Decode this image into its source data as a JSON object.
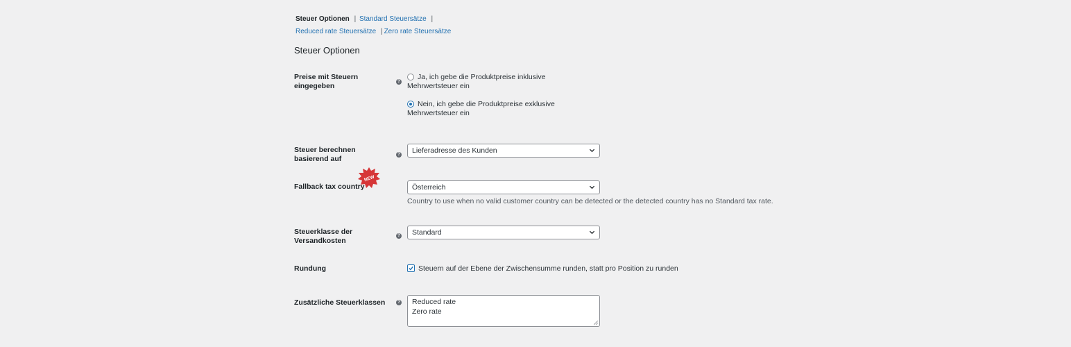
{
  "subnav": {
    "items": [
      {
        "label": "Steuer Optionen",
        "current": true
      },
      {
        "label": "Standard Steuersätze"
      },
      {
        "label": "Reduced rate Steuersätze"
      },
      {
        "label": "Zero rate Steuersätze"
      }
    ],
    "separator": "|"
  },
  "section_title": "Steuer Optionen",
  "help_glyph": "?",
  "fields": {
    "prices_entered": {
      "label": "Preise mit Steuern eingegeben",
      "options": [
        {
          "label": "Ja, ich gebe die Produktpreise inklusive Mehrwertsteuer ein",
          "checked": false
        },
        {
          "label": "Nein, ich gebe die Produktpreise exklusive Mehrwertsteuer ein",
          "checked": true
        }
      ]
    },
    "tax_based_on": {
      "label": "Steuer berechnen basierend auf",
      "value": "Lieferadresse des Kunden"
    },
    "fallback_country": {
      "label": "Fallback tax country",
      "value": "Österreich",
      "description": "Country to use when no valid customer country can be detected or the detected country has no Standard tax rate.",
      "badge": "NEW",
      "badge_color": "#d63638"
    },
    "shipping_tax_class": {
      "label": "Steuerklasse der Versandkosten",
      "value": "Standard"
    },
    "rounding": {
      "label": "Rundung",
      "checkbox_label": "Steuern auf der Ebene der Zwischensumme runden, statt pro Position zu runden",
      "checked": true
    },
    "additional_classes": {
      "label": "Zusätzliche Steuerklassen",
      "lines": [
        "Reduced rate",
        "Zero rate"
      ]
    }
  },
  "colors": {
    "link": "#2271b1",
    "background": "#f0f0f1",
    "text": "#1d2327"
  }
}
